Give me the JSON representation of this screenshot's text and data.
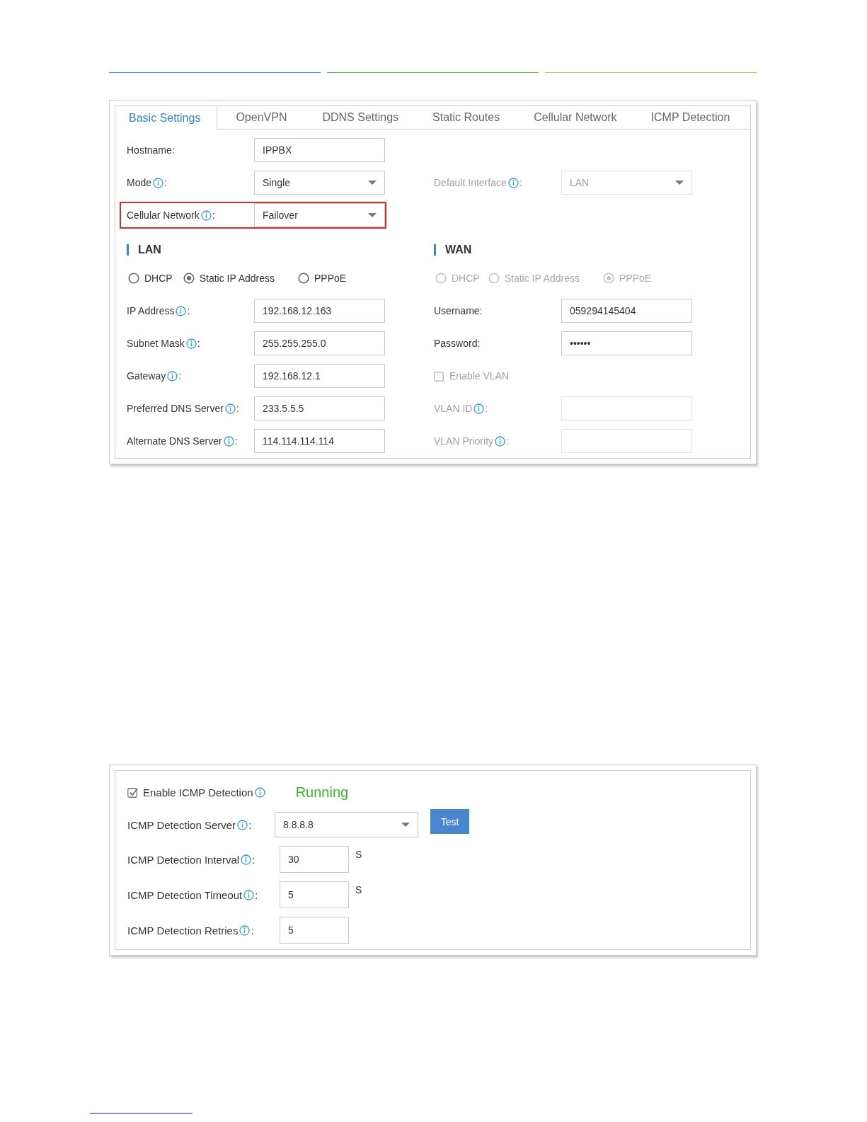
{
  "header_rules": [
    {
      "color": "#2d9be0"
    },
    {
      "color": "#5dbb3c"
    },
    {
      "color": "#f0b43c"
    }
  ],
  "network": {
    "tabs": [
      {
        "label": "Basic Settings",
        "selected": true
      },
      {
        "label": "OpenVPN",
        "selected": false
      },
      {
        "label": "DDNS Settings",
        "selected": false
      },
      {
        "label": "Static Routes",
        "selected": false
      },
      {
        "label": "Cellular Network",
        "selected": false
      },
      {
        "label": "ICMP Detection",
        "selected": false
      }
    ],
    "general": [
      {
        "label": "Hostname",
        "suffix": ":",
        "info": false,
        "kind": "text",
        "value": "IPPBX",
        "disabled": false,
        "highlighted": false
      },
      {
        "label": "Mode",
        "suffix": ":",
        "info": true,
        "kind": "select",
        "value": "Single",
        "disabled": false,
        "highlighted": false
      },
      {
        "label": "Cellular Network",
        "suffix": ":",
        "info": true,
        "kind": "select",
        "value": "Failover",
        "disabled": false,
        "highlighted": true
      }
    ],
    "default_interface": {
      "label": "Default Interface",
      "suffix": ":",
      "info": true,
      "kind": "select",
      "value": "LAN",
      "disabled": true,
      "highlighted": false
    },
    "lan": {
      "title": "LAN",
      "modes": [
        {
          "label": "DHCP",
          "selected": false,
          "disabled": false
        },
        {
          "label": "Static IP Address",
          "selected": true,
          "disabled": false
        },
        {
          "label": "PPPoE",
          "selected": false,
          "disabled": false
        }
      ],
      "fields": [
        {
          "label": "IP Address",
          "suffix": ":",
          "info": true,
          "kind": "text",
          "value": "192.168.12.163",
          "disabled": false
        },
        {
          "label": "Subnet Mask",
          "suffix": ":",
          "info": true,
          "kind": "text",
          "value": "255.255.255.0",
          "disabled": false
        },
        {
          "label": "Gateway",
          "suffix": ":",
          "info": true,
          "kind": "text",
          "value": "192.168.12.1",
          "disabled": false
        },
        {
          "label": "Preferred DNS Server",
          "suffix": ":",
          "info": true,
          "kind": "text",
          "value": "233.5.5.5",
          "disabled": false
        },
        {
          "label": "Alternate DNS Server",
          "suffix": ":",
          "info": true,
          "kind": "text",
          "value": "114.114.114.114",
          "disabled": false
        }
      ]
    },
    "wan": {
      "title": "WAN",
      "modes": [
        {
          "label": "DHCP",
          "selected": false,
          "disabled": true
        },
        {
          "label": "Static IP Address",
          "selected": false,
          "disabled": true
        },
        {
          "label": "PPPoE",
          "selected": true,
          "disabled": true
        }
      ],
      "fields": [
        {
          "label": "Username",
          "suffix": ":",
          "info": false,
          "kind": "text",
          "value": "059294145404",
          "disabled": false
        },
        {
          "label": "Password",
          "suffix": ":",
          "info": false,
          "kind": "password",
          "value": "••••••",
          "disabled": false
        },
        {
          "label": "Enable VLAN",
          "kind": "checkbox",
          "checked": false,
          "disabled": true
        },
        {
          "label": "VLAN ID",
          "suffix": ":",
          "info": true,
          "kind": "text",
          "disabled": true
        },
        {
          "label": "VLAN Priority",
          "suffix": ":",
          "info": true,
          "kind": "text",
          "disabled": true
        }
      ]
    }
  },
  "icmp": {
    "enable": {
      "label": "Enable ICMP Detection",
      "checked": true,
      "info": true
    },
    "status": "Running",
    "rows": [
      {
        "label": "ICMP Detection Server",
        "suffix": ":",
        "info": true,
        "kind": "select",
        "value": "8.8.8.8",
        "button": "Test"
      },
      {
        "label": "ICMP Detection Interval",
        "suffix": ":",
        "info": true,
        "kind": "text",
        "value": "30",
        "unit": "S"
      },
      {
        "label": "ICMP Detection Timeout",
        "suffix": ":",
        "info": true,
        "kind": "text",
        "value": "5",
        "unit": "S"
      },
      {
        "label": "ICMP Detection Retries",
        "suffix": ":",
        "info": true,
        "kind": "text",
        "value": "5"
      }
    ]
  }
}
